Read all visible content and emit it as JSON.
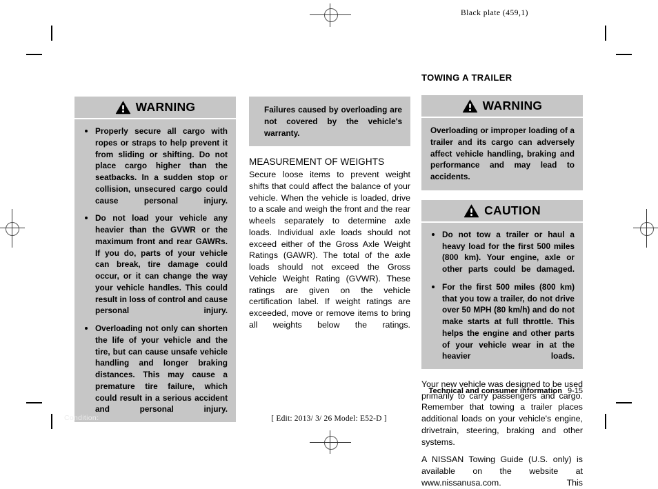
{
  "header": {
    "plate_label": "Black plate (459,1)"
  },
  "column1": {
    "warning": {
      "icon": "warning-triangle-icon",
      "title": "WARNING",
      "bullets": [
        "Properly secure all cargo with ropes or straps to help prevent it from sliding or shifting. Do not place cargo higher than the seatbacks. In a sudden stop or collision, unsecured cargo could cause personal injury.",
        "Do not load your vehicle any heavier than the GVWR or the maximum front and rear GAWRs. If you do, parts of your vehicle can break, tire damage could occur, or it can change the way your vehicle handles. This could result in loss of control and cause personal injury.",
        "Overloading not only can shorten the life of your vehicle and the tire, but can cause unsafe vehicle handling and longer braking distances. This may cause a premature tire failure, which could result in a serious accident and personal injury."
      ]
    }
  },
  "column2": {
    "warning_continued": "Failures caused by overloading are not covered by the vehicle's warranty.",
    "subheading": "MEASUREMENT OF WEIGHTS",
    "paragraphs": [
      "Secure loose items to prevent weight shifts that could affect the balance of your vehicle. When the vehicle is loaded, drive to a scale and weigh the front and the rear wheels separately to determine axle loads. Individual axle loads should not exceed either of the Gross Axle Weight Ratings (GAWR). The total of the axle loads should not exceed the Gross Vehicle Weight Rating (GVWR). These ratings are given on the vehicle certification label. If weight ratings are exceeded, move or remove items to bring all weights below the ratings."
    ]
  },
  "column3": {
    "heading": "TOWING A TRAILER",
    "warning": {
      "icon": "warning-triangle-icon",
      "title": "WARNING",
      "body": "Overloading or improper loading of a trailer and its cargo can adversely affect vehicle handling, braking and performance and may lead to accidents."
    },
    "caution": {
      "icon": "caution-triangle-icon",
      "title": "CAUTION",
      "bullets": [
        "Do not tow a trailer or haul a heavy load for the first 500 miles (800 km). Your engine, axle or other parts could be damaged.",
        "For the first 500 miles (800 km) that you tow a trailer, do not drive over 50 MPH (80 km/h) and do not make starts at full throttle. This helps the engine and other parts of your vehicle wear in at the heavier loads."
      ]
    },
    "paragraphs": [
      "Your new vehicle was designed to be used primarily to carry passengers and cargo. Remember that towing a trailer places additional loads on your vehicle's engine, drivetrain, steering, braking and other systems.",
      "A NISSAN Towing Guide (U.S. only) is available on the website at www.nissanusa.com. This"
    ]
  },
  "footer": {
    "chapter": "Technical and consumer information",
    "page_number": "9-15",
    "condition_label": "Condition:",
    "edit_mark": "[ Edit: 2013/ 3/ 26   Model: E52-D ]"
  },
  "colors": {
    "alert_background": "#c6c6c6",
    "text": "#000000",
    "condition_text": "#ececec"
  }
}
